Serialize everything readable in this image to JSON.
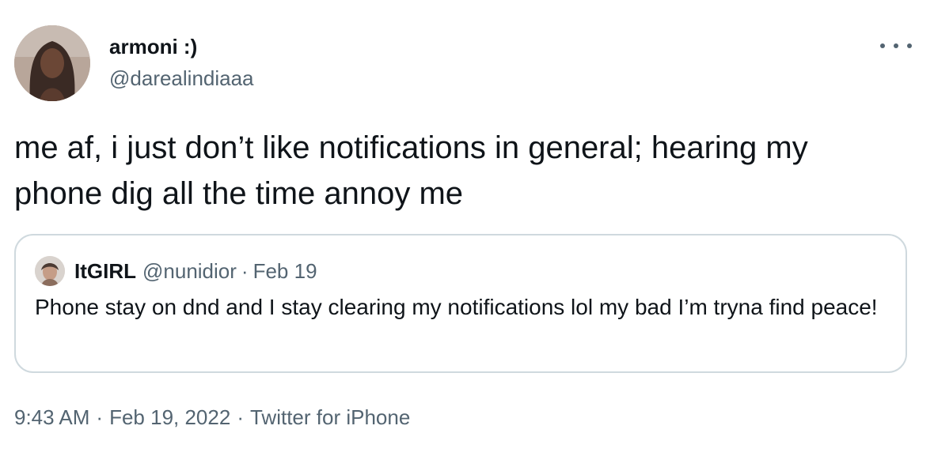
{
  "tweet": {
    "author_name": "armoni :)",
    "author_handle": "@darealindiaaa",
    "text": "me af, i just don’t like notifications in general; hearing my phone dig all the time annoy me",
    "more_icon": "more-horizontal-icon"
  },
  "quote": {
    "author_name": "ItGIRL",
    "author_handle": "@nunidior",
    "separator": "·",
    "date": "Feb 19",
    "text": "Phone stay on dnd and I stay clearing my notifications lol my bad I’m tryna find peace!"
  },
  "footer": {
    "time": "9:43 AM",
    "separator": "·",
    "date": "Feb 19, 2022",
    "source": "Twitter for iPhone"
  },
  "colors": {
    "text_primary": "#0f1419",
    "text_secondary": "#536471",
    "border": "#cfd9de"
  }
}
